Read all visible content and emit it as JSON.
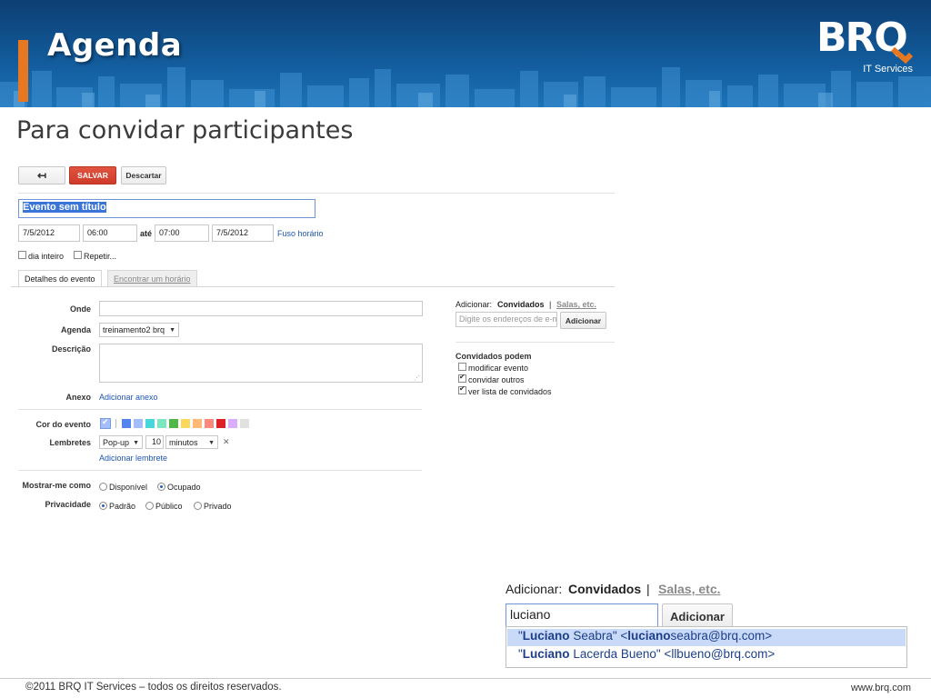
{
  "slide": {
    "title": "Agenda",
    "subtitle": "Para convidar participantes",
    "logo_text": "BRQ",
    "logo_subtext": "IT Services",
    "footer_left": "©2011 BRQ IT Services – todos os direitos reservados.",
    "footer_right": "www.brq.com",
    "colors": {
      "banner": "#125a9a",
      "accent": "#e87722"
    }
  },
  "toolbar": {
    "back_icon": "back-arrow-icon",
    "save_label": "SALVAR",
    "discard_label": "Descartar"
  },
  "event": {
    "title": "Evento sem título",
    "start_date": "7/5/2012",
    "start_time": "06:00",
    "until_label": "até",
    "end_time": "07:00",
    "end_date": "7/5/2012",
    "timezone_link": "Fuso horário",
    "allday_label": "dia inteiro",
    "repeat_label": "Repetir..."
  },
  "tabs": {
    "details": "Detalhes do evento",
    "find_time": "Encontrar um horário"
  },
  "details": {
    "where_label": "Onde",
    "where_value": "",
    "calendar_label": "Agenda",
    "calendar_value": "treinamento2 brq",
    "description_label": "Descrição",
    "attachment_label": "Anexo",
    "attachment_link": "Adicionar anexo",
    "color_label": "Cor do evento",
    "colors": [
      "#5484ed",
      "#a4bdfc",
      "#46d6db",
      "#7ae7bf",
      "#51b749",
      "#fbd75b",
      "#ffb878",
      "#ff887c",
      "#dc2127",
      "#dbadff",
      "#e1e1e1"
    ],
    "reminders_label": "Lembretes",
    "reminder_type": "Pop-up",
    "reminder_value": "10",
    "reminder_unit": "minutos",
    "add_reminder_link": "Adicionar lembrete",
    "show_as_label": "Mostrar-me como",
    "show_as_options": [
      "Disponível",
      "Ocupado"
    ],
    "show_as_selected": "Ocupado",
    "privacy_label": "Privacidade",
    "privacy_options": [
      "Padrão",
      "Público",
      "Privado"
    ],
    "privacy_selected": "Padrão"
  },
  "guests": {
    "add_label": "Adicionar:",
    "guests_tab": "Convidados",
    "separator": "|",
    "rooms_tab": "Salas, etc.",
    "input_placeholder": "Digite os endereços de e-mail",
    "add_button": "Adicionar",
    "permissions_title": "Convidados podem",
    "permissions": [
      {
        "label": "modificar evento",
        "checked": false
      },
      {
        "label": "convidar outros",
        "checked": true
      },
      {
        "label": "ver lista de convidados",
        "checked": true
      }
    ]
  },
  "zoom_panel": {
    "add_label": "Adicionar:",
    "guests_tab": "Convidados",
    "separator": "|",
    "rooms_tab": "Salas, etc.",
    "input_value": "luciano",
    "add_button": "Adicionar",
    "suggestions": [
      {
        "q1": "\"",
        "name_bold": "Luciano",
        "name_rest": " Seabra\" <",
        "email_bold": "luciano",
        "email_rest": "seabra@brq.com>"
      },
      {
        "q1": "\"",
        "name_bold": "Luciano",
        "name_rest": " Lacerda Bueno\" <llbueno@brq.com>",
        "email_bold": "",
        "email_rest": ""
      }
    ]
  }
}
